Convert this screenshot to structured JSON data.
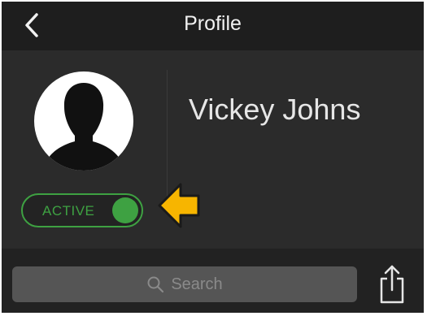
{
  "header": {
    "title": "Profile",
    "back_icon": "chevron-left-icon"
  },
  "profile": {
    "name": "Vickey Johns",
    "avatar_icon": "user-silhouette-icon",
    "status": {
      "label": "ACTIVE",
      "on": true,
      "color": "#3ea142"
    }
  },
  "annotation": {
    "arrow_icon": "arrow-left-icon",
    "color": "#f7b500"
  },
  "search": {
    "placeholder": "Search",
    "icon": "search-icon"
  },
  "actions": {
    "share_icon": "share-icon"
  },
  "colors": {
    "header_bg": "#1e1e1e",
    "panel_bg": "#2b2b2b",
    "search_field_bg": "#555555"
  }
}
